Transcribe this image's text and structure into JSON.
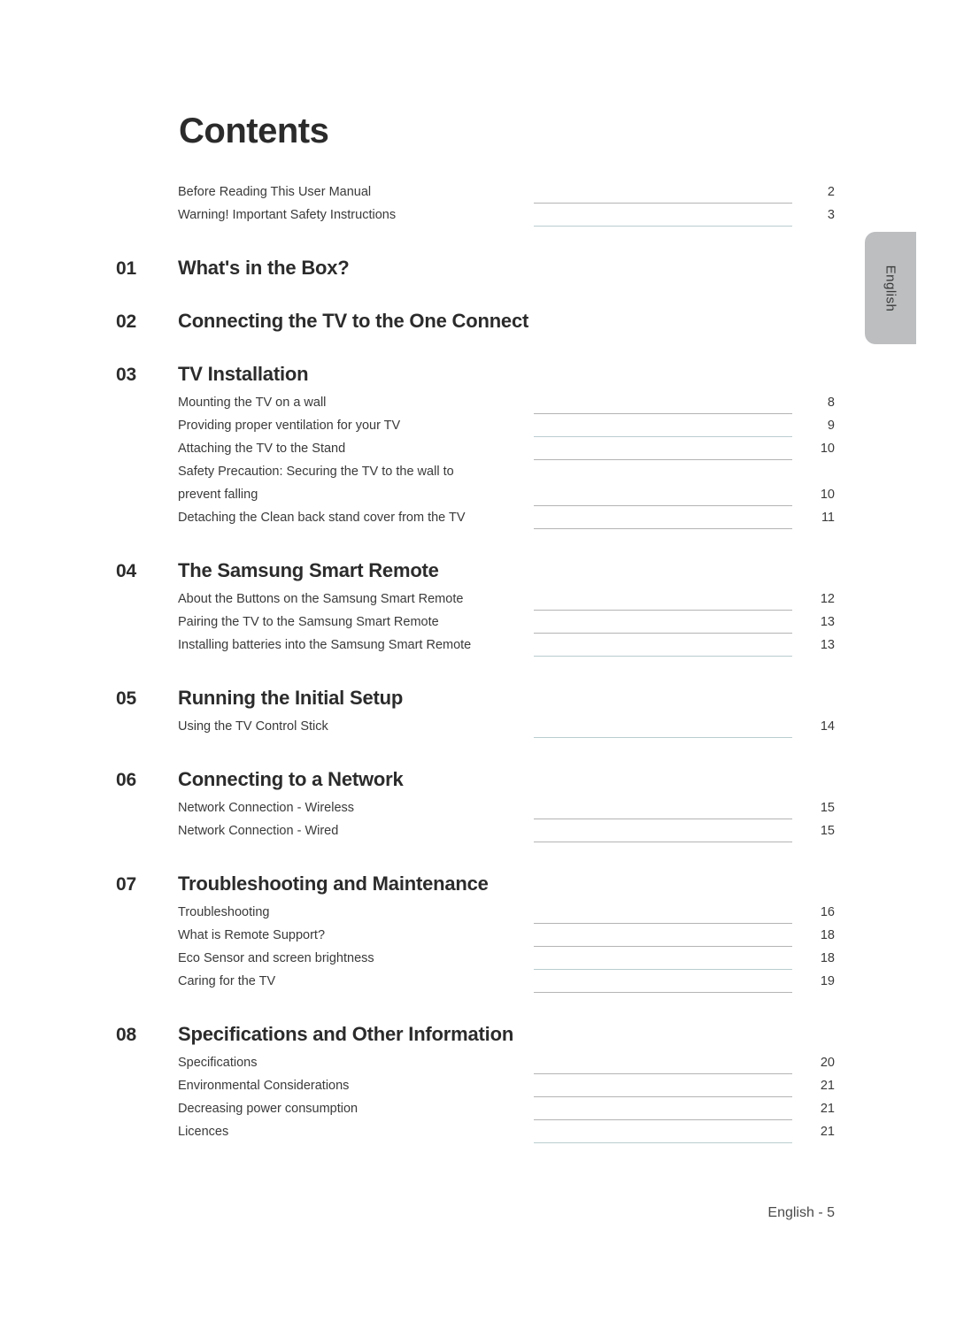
{
  "page": {
    "title": "Contents",
    "footer": "English - 5",
    "side_tab_label": "English",
    "side_tab_color": "#bcbec0",
    "leader_color": "#b4b4b4",
    "leader_color_alt": "#b9cdd0",
    "text_color": "#333333"
  },
  "preamble": {
    "entries": [
      {
        "label": "Before Reading This User Manual",
        "page": "2",
        "leader": "gray"
      },
      {
        "label": "Warning! Important Safety Instructions",
        "page": "3",
        "leader": "teal"
      }
    ]
  },
  "chapters": [
    {
      "number": "01",
      "title": "What's in the Box?",
      "entries": []
    },
    {
      "number": "02",
      "title": "Connecting the TV to the One Connect",
      "entries": []
    },
    {
      "number": "03",
      "title": "TV Installation",
      "entries": [
        {
          "label": "Mounting the TV on a wall",
          "page": "8",
          "leader": "gray"
        },
        {
          "label": "Providing proper ventilation for your TV",
          "page": "9",
          "leader": "teal"
        },
        {
          "label": "Attaching the TV to the Stand",
          "page": "10",
          "leader": "gray"
        },
        {
          "label": "Safety Precaution: Securing the TV to the wall to",
          "page": "",
          "leader": "none"
        },
        {
          "label": "prevent falling",
          "page": "10",
          "leader": "gray"
        },
        {
          "label": "Detaching the Clean back stand cover from the TV",
          "page": "11",
          "leader": "gray"
        }
      ]
    },
    {
      "number": "04",
      "title": "The Samsung Smart Remote",
      "entries": [
        {
          "label": "About the Buttons on the Samsung Smart Remote",
          "page": "12",
          "leader": "gray"
        },
        {
          "label": "Pairing the TV to the Samsung Smart Remote",
          "page": "13",
          "leader": "gray"
        },
        {
          "label": "Installing batteries into the Samsung Smart Remote",
          "page": "13",
          "leader": "teal"
        }
      ]
    },
    {
      "number": "05",
      "title": "Running the Initial Setup",
      "entries": [
        {
          "label": "Using the TV Control Stick",
          "page": "14",
          "leader": "teal"
        }
      ]
    },
    {
      "number": "06",
      "title": "Connecting to a Network",
      "entries": [
        {
          "label": "Network Connection - Wireless",
          "page": "15",
          "leader": "gray"
        },
        {
          "label": "Network Connection - Wired",
          "page": "15",
          "leader": "gray"
        }
      ]
    },
    {
      "number": "07",
      "title": "Troubleshooting and Maintenance",
      "entries": [
        {
          "label": "Troubleshooting",
          "page": "16",
          "leader": "gray"
        },
        {
          "label": "What is Remote Support?",
          "page": "18",
          "leader": "gray"
        },
        {
          "label": "Eco Sensor and screen brightness",
          "page": "18",
          "leader": "teal"
        },
        {
          "label": "Caring for the TV",
          "page": "19",
          "leader": "gray"
        }
      ]
    },
    {
      "number": "08",
      "title": "Specifications and Other Information",
      "entries": [
        {
          "label": "Specifications",
          "page": "20",
          "leader": "gray"
        },
        {
          "label": "Environmental Considerations",
          "page": "21",
          "leader": "gray"
        },
        {
          "label": "Decreasing power consumption",
          "page": "21",
          "leader": "gray"
        },
        {
          "label": "Licences",
          "page": "21",
          "leader": "teal"
        }
      ]
    }
  ]
}
